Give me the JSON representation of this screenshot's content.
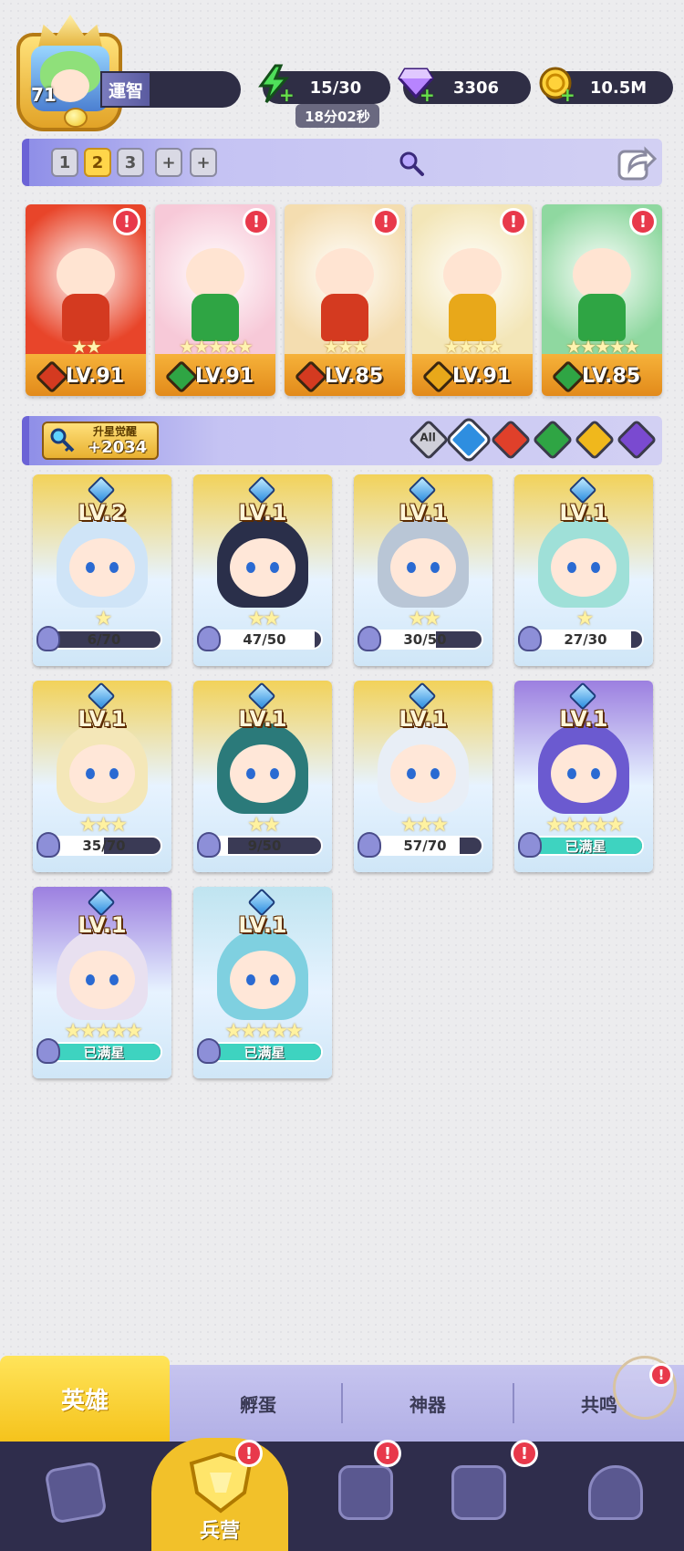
{
  "player": {
    "level": "71",
    "name": "運智",
    "avatar_icon": "player-avatar"
  },
  "resources": {
    "energy": "15/30",
    "energy_timer": "18分02秒",
    "gems": "3306",
    "coins": "10.5M"
  },
  "team_slots": [
    "1",
    "2",
    "3",
    "+",
    "+"
  ],
  "active_team_slot": "2",
  "team": [
    {
      "level": "LV.91",
      "stars": "★★",
      "element": "fire",
      "color": "#d43a20",
      "bg": "#e8452a"
    },
    {
      "level": "LV.91",
      "stars": "★★★★★",
      "element": "nature",
      "color": "#2fa544",
      "bg": "#f7c9d8"
    },
    {
      "level": "LV.85",
      "stars": "★★★",
      "element": "fire",
      "color": "#d43a20",
      "bg": "#f4ddb0"
    },
    {
      "level": "LV.91",
      "stars": "★★★★",
      "element": "light",
      "color": "#e8a81a",
      "bg": "#f3e6b8"
    },
    {
      "level": "LV.85",
      "stars": "★★★★★",
      "element": "nature",
      "color": "#2fa544",
      "bg": "#8fd8a0"
    }
  ],
  "awaken": {
    "label": "升星觉醒",
    "value": "+2034"
  },
  "filter": {
    "all_label": "All",
    "elements": [
      {
        "name": "water",
        "color": "#2e8ee0"
      },
      {
        "name": "fire",
        "color": "#e0402a"
      },
      {
        "name": "nature",
        "color": "#2fa544"
      },
      {
        "name": "light",
        "color": "#f0b81c"
      },
      {
        "name": "dark",
        "color": "#7a4ad0"
      }
    ]
  },
  "heroes": [
    {
      "level": "LV.2",
      "stars": "★",
      "progress": "6/70",
      "fill": 0.086,
      "full": false,
      "bg": "#f2d25a",
      "hair": "#cfe4f7"
    },
    {
      "level": "LV.1",
      "stars": "★★",
      "progress": "47/50",
      "fill": 0.94,
      "full": false,
      "bg": "#f2d25a",
      "hair": "#2a2f4a"
    },
    {
      "level": "LV.1",
      "stars": "★★",
      "progress": "30/50",
      "fill": 0.6,
      "full": false,
      "bg": "#f2d25a",
      "hair": "#b9c6d6"
    },
    {
      "level": "LV.1",
      "stars": "★",
      "progress": "27/30",
      "fill": 0.9,
      "full": false,
      "bg": "#f2d25a",
      "hair": "#9fe0d8"
    },
    {
      "level": "LV.1",
      "stars": "★★★",
      "progress": "35/70",
      "fill": 0.5,
      "full": false,
      "bg": "#f2d25a",
      "hair": "#f4e7b8"
    },
    {
      "level": "LV.1",
      "stars": "★★",
      "progress": "9/50",
      "fill": 0.18,
      "full": false,
      "bg": "#f2d25a",
      "hair": "#2b7a7a"
    },
    {
      "level": "LV.1",
      "stars": "★★★",
      "progress": "57/70",
      "fill": 0.81,
      "full": false,
      "bg": "#f2d25a",
      "hair": "#e8eef6"
    },
    {
      "level": "LV.1",
      "stars": "★★★★★",
      "progress": "已满星",
      "fill": 1.0,
      "full": true,
      "bg": "#9c7fe0",
      "hair": "#6b5ad0"
    },
    {
      "level": "LV.1",
      "stars": "★★★★★",
      "progress": "已满星",
      "fill": 1.0,
      "full": true,
      "bg": "#9c7fe0",
      "hair": "#e8e0f0"
    },
    {
      "level": "LV.1",
      "stars": "★★★★★",
      "progress": "已满星",
      "fill": 1.0,
      "full": true,
      "bg": "#bfe4f0",
      "hair": "#7fd0e0"
    }
  ],
  "tabs": [
    "英雄",
    "孵蛋",
    "神器",
    "共鸣"
  ],
  "nav": {
    "barracks_label": "兵营"
  },
  "alert_mark": "!"
}
